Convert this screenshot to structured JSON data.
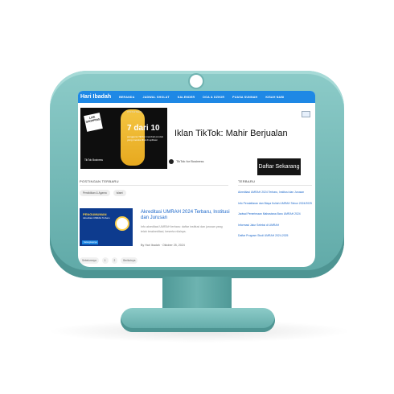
{
  "nav": {
    "logo": "Hari Ibadah",
    "items": [
      "BERANDA",
      "JADWAL SHOLAT",
      "KALENDER",
      "DOA & DZIKIR",
      "PUASA SUNNAH",
      "KISAH NABI"
    ]
  },
  "ad": {
    "badge": "i",
    "image_top": "#TikTokTalent",
    "image_tag": "LIVE SHOPPING",
    "image_big": "7 dari 10",
    "image_small": "pengguna TikTok membeli produk yang mereka lihat di aplikasi",
    "image_brand": "TikTok Business",
    "title": "Iklan TikTok: Mahir Berjualan",
    "sponsor": "TikTok for Business",
    "cta": "Daftar Sekarang"
  },
  "main": {
    "section_title": "POSTINGAN TERBARU",
    "chips": [
      "Pendidikan & Agama",
      "Islami"
    ],
    "card": {
      "image_title": "PENGUMUMAN",
      "image_text": "Akreditasi UMRAH Terbaru",
      "image_button": "Selengkapnya",
      "title": "Akreditasi UMRAH 2024 Terbaru, Institusi dan Jurusan",
      "excerpt": "Info akreditasi UMRAH terbaru: daftar institusi dan jurusan yang telah terakreditasi, beserta nilainya.",
      "meta": "By Hari Ibadah · Oktober 25, 2024"
    },
    "pager": [
      "Sebelumnya",
      "1",
      "2",
      "Berikutnya"
    ]
  },
  "sidebar": {
    "title": "TERBARU",
    "items": [
      "Akreditasi UMRAH 2024 Terbaru, Institusi dan Jurusan",
      "Info Pendaftaran dan Biaya Kuliah UMRAH Tahun 2024/2025",
      "Jadwal Penerimaan Mahasiswa Baru UMRAH 2024",
      "Informasi Jalur Seleksi di UMRAH",
      "Daftar Program Studi UMRAH 2024-2025"
    ]
  },
  "colors": {
    "nav": "#1e88e5",
    "bezel": "#6fb3b1",
    "link": "#1a66c9"
  }
}
